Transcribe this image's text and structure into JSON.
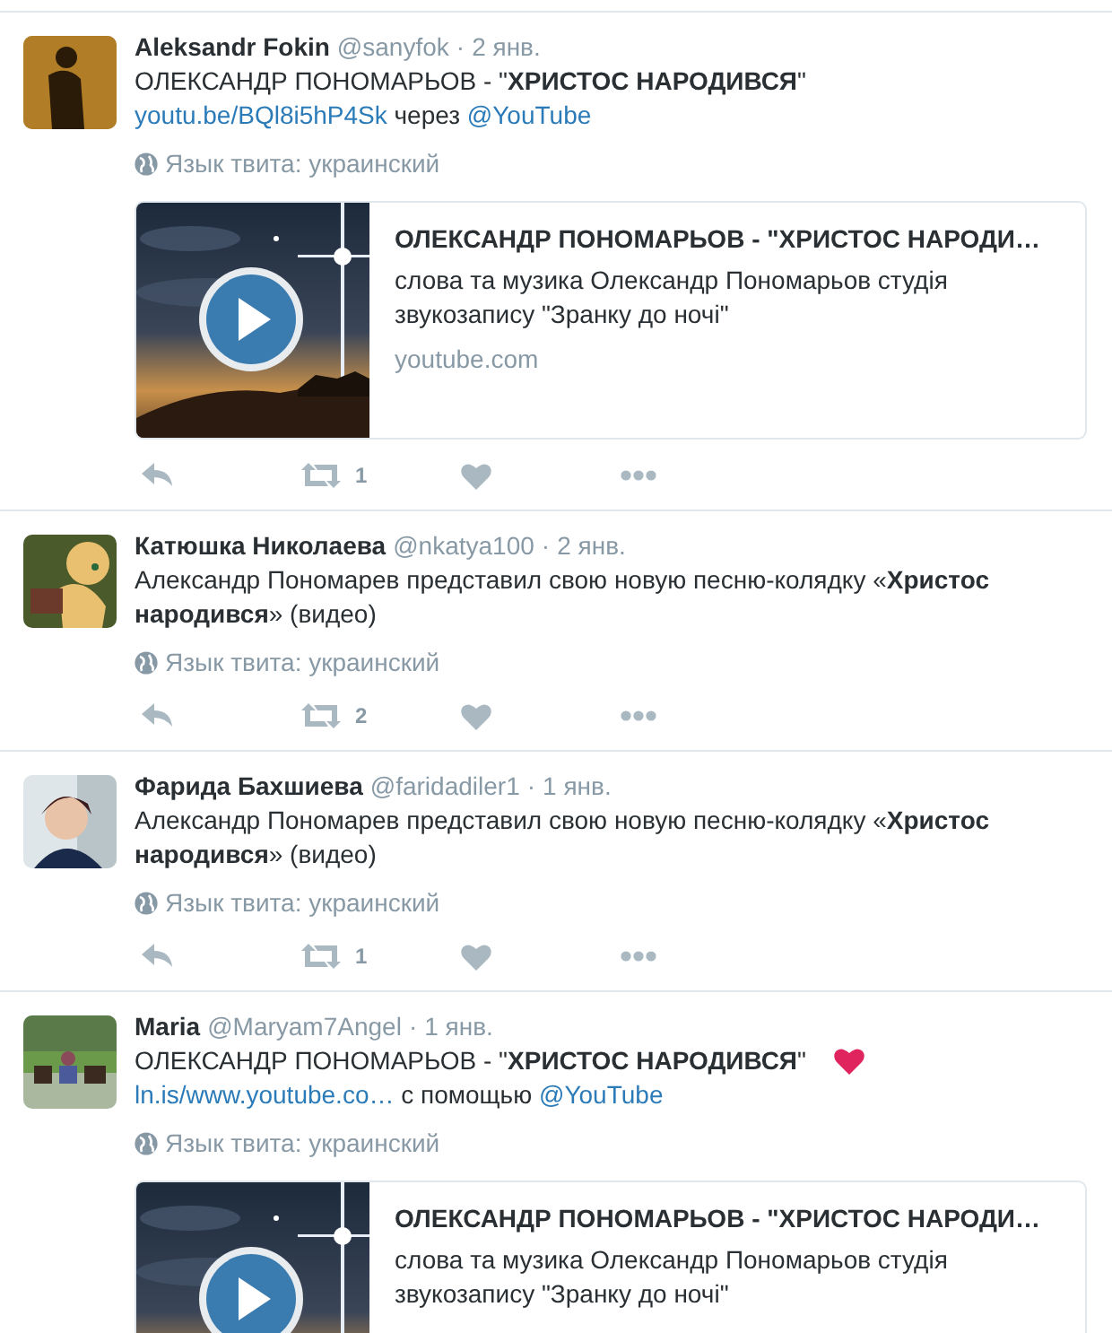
{
  "tweets": [
    {
      "author": "Aleksandr Fokin",
      "handle": "@sanyfok",
      "separator": "·",
      "time": "2 янв.",
      "body": [
        [
          {
            "kind": "text",
            "text": "ОЛЕКСАНДР ПОНОМАРЬОВ - \"**ХРИСТОС НАРОДИВСЯ**\""
          }
        ],
        [
          {
            "kind": "link",
            "text": "youtu.be/BQl8i5hP4Sk"
          },
          {
            "kind": "text",
            "text": " через "
          },
          {
            "kind": "link",
            "text": "@YouTube"
          }
        ]
      ],
      "language": "Язык твита: украинский",
      "card": {
        "kind": "picture",
        "title": "ОЛЕКСАНДР ПОНОМАРЬОВ - \"ХРИСТОС НАРОДИ…",
        "description": "слова та музика Олександр Пономарьов студія звукозапису \"Зранку до ночі\"",
        "domain": "youtube.com"
      },
      "retweets": "1"
    },
    {
      "author": "Катюшка Николаева",
      "handle": "@nkatya100",
      "separator": "·",
      "time": "2 янв.",
      "body": [
        [
          {
            "kind": "text",
            "text": "Александр Пономарев представил свою новую песню-колядку «**Христос народився**» (видео)"
          }
        ]
      ],
      "language": "Язык твита: украинский",
      "retweets": "2"
    },
    {
      "author": "Фарида Бахшиева",
      "handle": "@faridadiler1",
      "separator": "·",
      "time": "1 янв.",
      "body": [
        [
          {
            "kind": "text",
            "text": "Александр Пономарев представил свою новую песню-колядку «**Христос народився**» (видео)"
          }
        ]
      ],
      "language": "Язык твита: украинский",
      "retweets": "1"
    },
    {
      "author": "Maria",
      "handle": "@Maryam7Angel",
      "separator": "·",
      "time": "1 янв.",
      "body": [
        [
          {
            "kind": "text",
            "text": "ОЛЕКСАНДР ПОНОМАРЬОВ - \"**ХРИСТОС НАРОДИВСЯ**\""
          }
        ],
        [
          {
            "kind": "link",
            "text": "ln.is/www.youtube.co…"
          },
          {
            "kind": "text",
            "text": " с помощью "
          },
          {
            "kind": "link",
            "text": "@YouTube"
          }
        ]
      ],
      "heart_emoji": true,
      "language": "Язык твита: украинский",
      "card": {
        "kind": "picture",
        "title": "ОЛЕКСАНДР ПОНОМАРЬОВ - \"ХРИСТОС НАРОДИ…",
        "description": "слова та музика Олександр Пономарьов студія звукозапису \"Зранку до ночі\""
      }
    }
  ]
}
